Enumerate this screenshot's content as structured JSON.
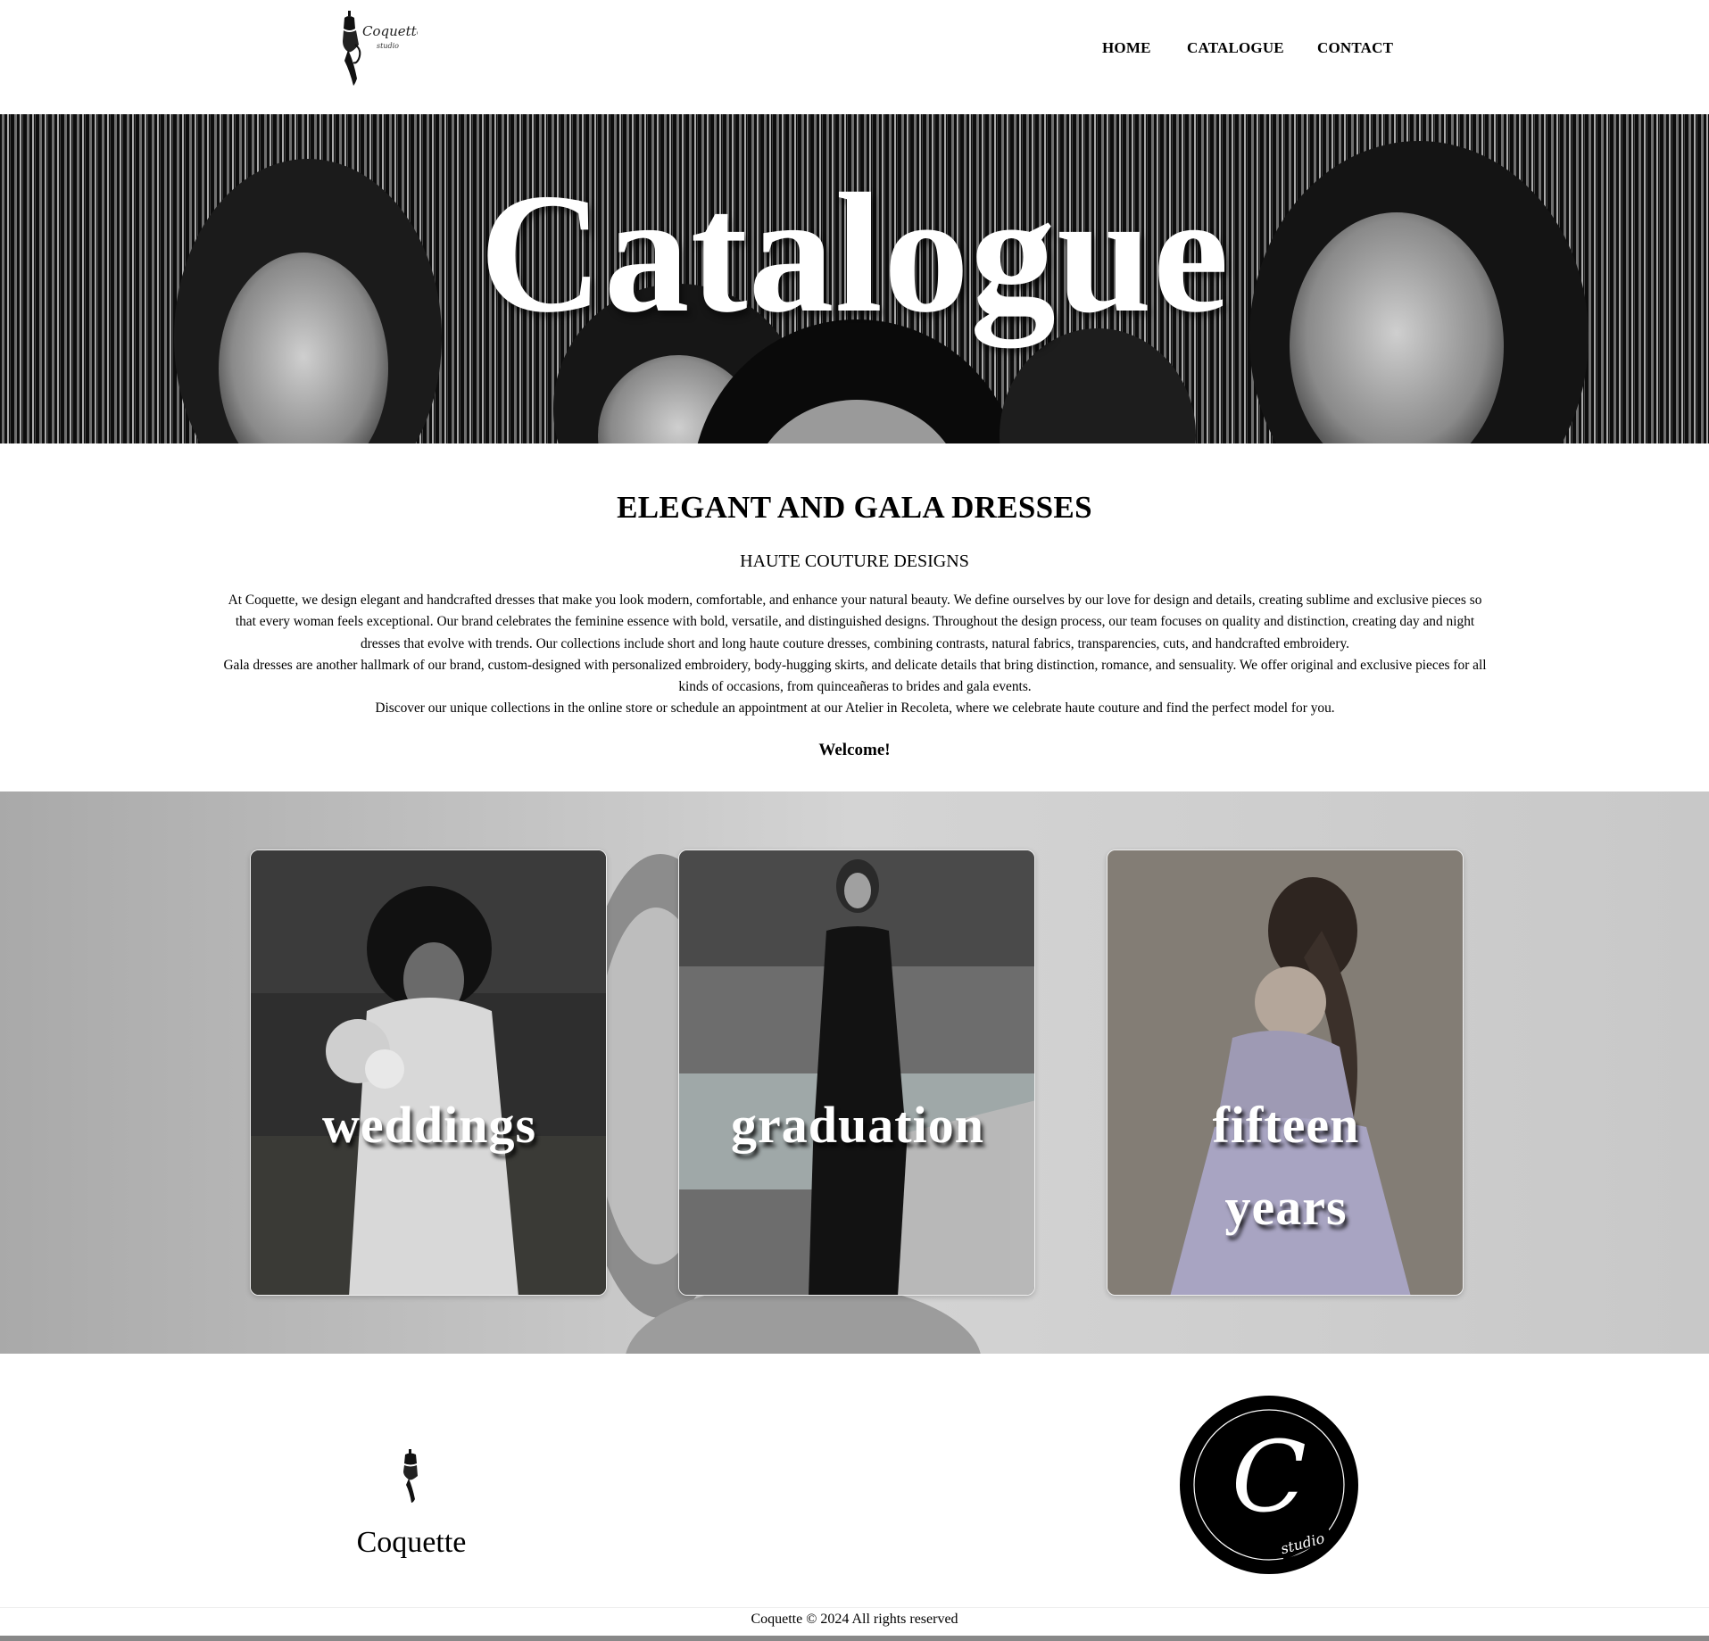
{
  "header": {
    "logo_script": "Coquette",
    "logo_sub": "studio",
    "nav": {
      "home": "HOME",
      "catalogue": "CATALOGUE",
      "contact": "CONTACT"
    }
  },
  "hero": {
    "title": "Catalogue"
  },
  "intro": {
    "heading": "ELEGANT AND GALA DRESSES",
    "subheading": "HAUTE COUTURE DESIGNS",
    "paragraphs": [
      "At Coquette, we design elegant and handcrafted dresses that make you look modern, comfortable, and enhance your natural beauty. We define ourselves by our love for design and details, creating sublime and exclusive pieces so that every woman feels exceptional. Our brand celebrates the feminine essence with bold, versatile, and distinguished designs. Throughout the design process, our team focuses on quality and distinction, creating day and night dresses that evolve with trends. Our collections include short and long haute couture dresses, combining contrasts, natural fabrics, transparencies, cuts, and handcrafted embroidery.",
      "Gala dresses are another hallmark of our brand, custom-designed with personalized embroidery, body-hugging skirts, and delicate details that bring distinction, romance, and sensuality. We offer original and exclusive pieces for all kinds of occasions, from quinceañeras to brides and gala events.",
      "Discover our unique collections in the online store or schedule an appointment at our Atelier in Recoleta, where we celebrate haute couture and find the perfect model for you."
    ],
    "welcome": "Welcome!"
  },
  "categories": {
    "weddings": "weddings",
    "graduation": "graduation",
    "fifteen_line1": "fifteen",
    "fifteen_line2": "years"
  },
  "footer": {
    "brand": "Coquette",
    "badge_letter": "C",
    "badge_sub": "studio",
    "copyright": "Coquette © 2024 All rights reserved"
  },
  "icons": {
    "logo": "dress-mannequin-icon",
    "footer_logo": "dress-mannequin-icon",
    "badge": "studio-circle-logo"
  }
}
